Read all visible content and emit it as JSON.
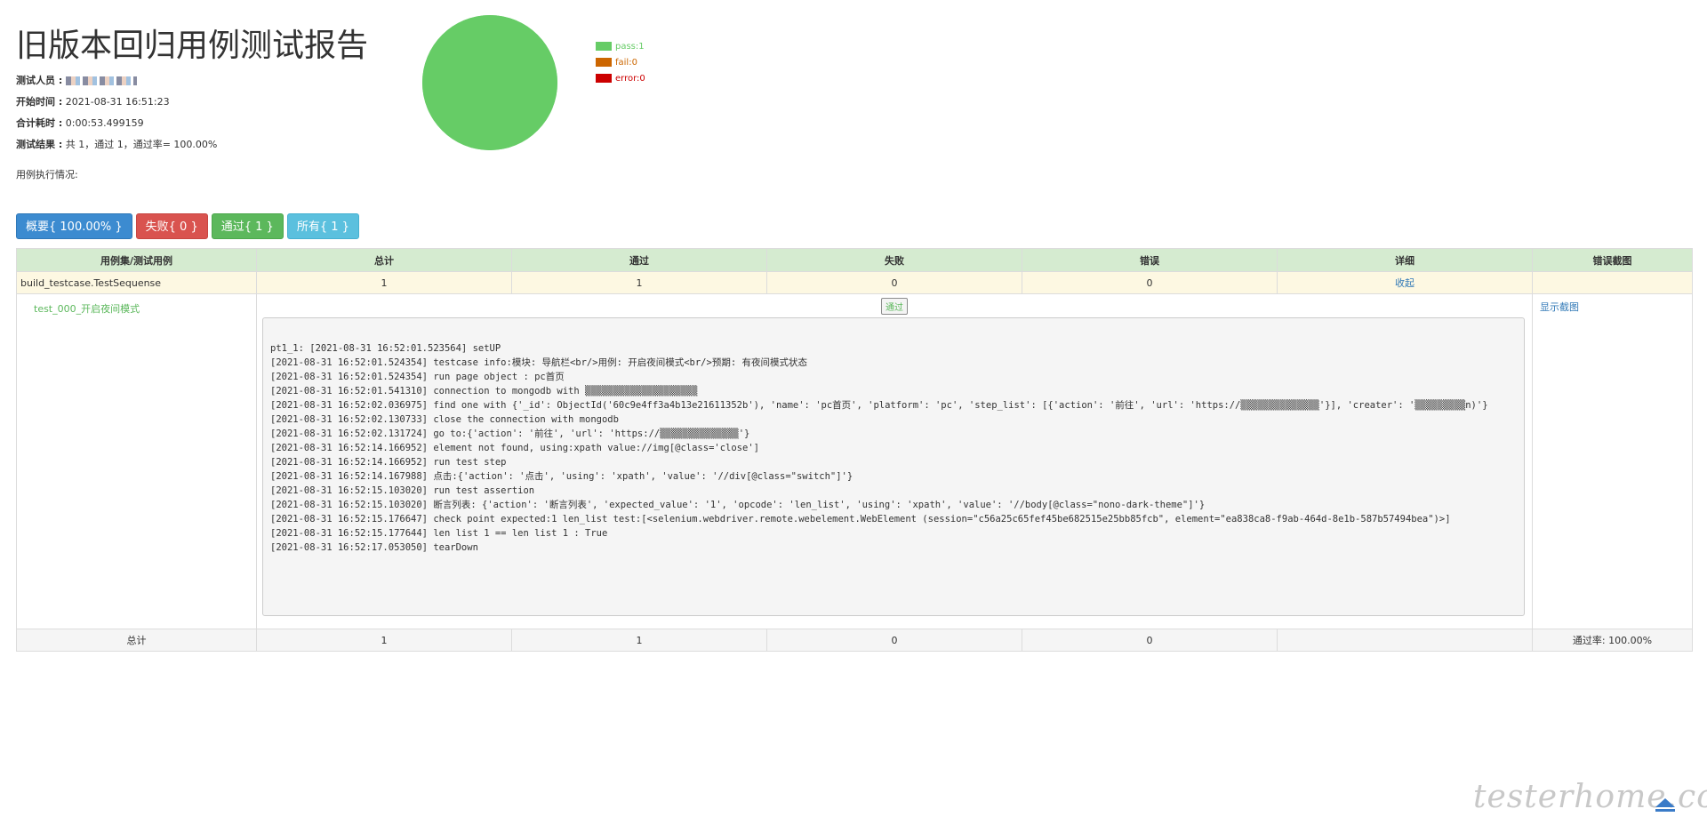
{
  "report": {
    "title": "旧版本回归用例测试报告",
    "tester_label": "测试人员 :",
    "start_label": "开始时间 :",
    "start_value": "2021-08-31 16:51:23",
    "duration_label": "合计耗时 :",
    "duration_value": "0:00:53.499159",
    "result_label": "测试结果 :",
    "result_value": "共 1，通过 1，通过率= 100.00%",
    "exec_label": "用例执行情况:"
  },
  "chart_data": {
    "type": "pie",
    "series": [
      {
        "name": "pass",
        "value": 1,
        "color": "#66cc66"
      },
      {
        "name": "fail",
        "value": 0,
        "color": "#cc6600"
      },
      {
        "name": "error",
        "value": 0,
        "color": "#cc0000"
      }
    ]
  },
  "legend": {
    "pass": "pass:1",
    "fail": "fail:0",
    "error": "error:0",
    "pass_color": "#66cc66",
    "fail_color": "#cc6600",
    "error_color": "#cc0000"
  },
  "filters": {
    "summary": "概要{ 100.00% }",
    "failed": "失败{ 0 }",
    "passed": "通过{ 1 }",
    "all": "所有{ 1 }"
  },
  "table": {
    "headers": [
      "用例集/测试用例",
      "总计",
      "通过",
      "失败",
      "错误",
      "详细",
      "错误截图"
    ],
    "class_row": {
      "name": "build_testcase.TestSequense",
      "total": "1",
      "pass": "1",
      "fail": "0",
      "error": "0",
      "detail": "收起"
    },
    "case_row": {
      "name": "test_000_开启夜间模式",
      "status": "通过",
      "screenshot": "显示截图",
      "log": [
        "pt1_1: [2021-08-31 16:52:01.523564] setUP",
        "[2021-08-31 16:52:01.524354] testcase info:模块: 导航栏<br/>用例: 开启夜间模式<br/>预期: 有夜间模式状态",
        "[2021-08-31 16:52:01.524354] run page object : pc首页",
        "[2021-08-31 16:52:01.541310] connection to mongodb with ▒▒▒▒▒▒▒▒▒▒▒▒▒▒▒▒▒▒▒▒",
        "[2021-08-31 16:52:02.036975] find one with {'_id': ObjectId('60c9e4ff3a4b13e21611352b'), 'name': 'pc首页', 'platform': 'pc', 'step_list': [{'action': '前往', 'url': 'https://▒▒▒▒▒▒▒▒▒▒▒▒▒▒'}], 'creater': '▒▒▒▒▒▒▒▒▒n)'}",
        "[2021-08-31 16:52:02.130733] close the connection with mongodb",
        "[2021-08-31 16:52:02.131724] go to:{'action': '前往', 'url': 'https://▒▒▒▒▒▒▒▒▒▒▒▒▒▒'}",
        "[2021-08-31 16:52:14.166952] element not found, using:xpath value://img[@class='close']",
        "[2021-08-31 16:52:14.166952] run test step",
        "[2021-08-31 16:52:14.167988] 点击:{'action': '点击', 'using': 'xpath', 'value': '//div[@class=\"switch\"]'}",
        "[2021-08-31 16:52:15.103020] run test assertion",
        "[2021-08-31 16:52:15.103020] 断言列表: {'action': '断言列表', 'expected_value': '1', 'opcode': 'len_list', 'using': 'xpath', 'value': '//body[@class=\"nono-dark-theme\"]'}",
        "[2021-08-31 16:52:15.176647] check point expected:1 len_list test:[<selenium.webdriver.remote.webelement.WebElement (session=\"c56a25c65fef45be682515e25bb85fcb\", element=\"ea838ca8-f9ab-464d-8e1b-587b57494bea\")>]",
        "[2021-08-31 16:52:15.177644] len list 1 == len list 1 : True",
        "[2021-08-31 16:52:17.053050] tearDown"
      ]
    },
    "total_row": {
      "label": "总计",
      "total": "1",
      "pass": "1",
      "fail": "0",
      "error": "0",
      "pass_rate": "通过率: 100.00%"
    }
  },
  "watermark": "testerhome.com"
}
